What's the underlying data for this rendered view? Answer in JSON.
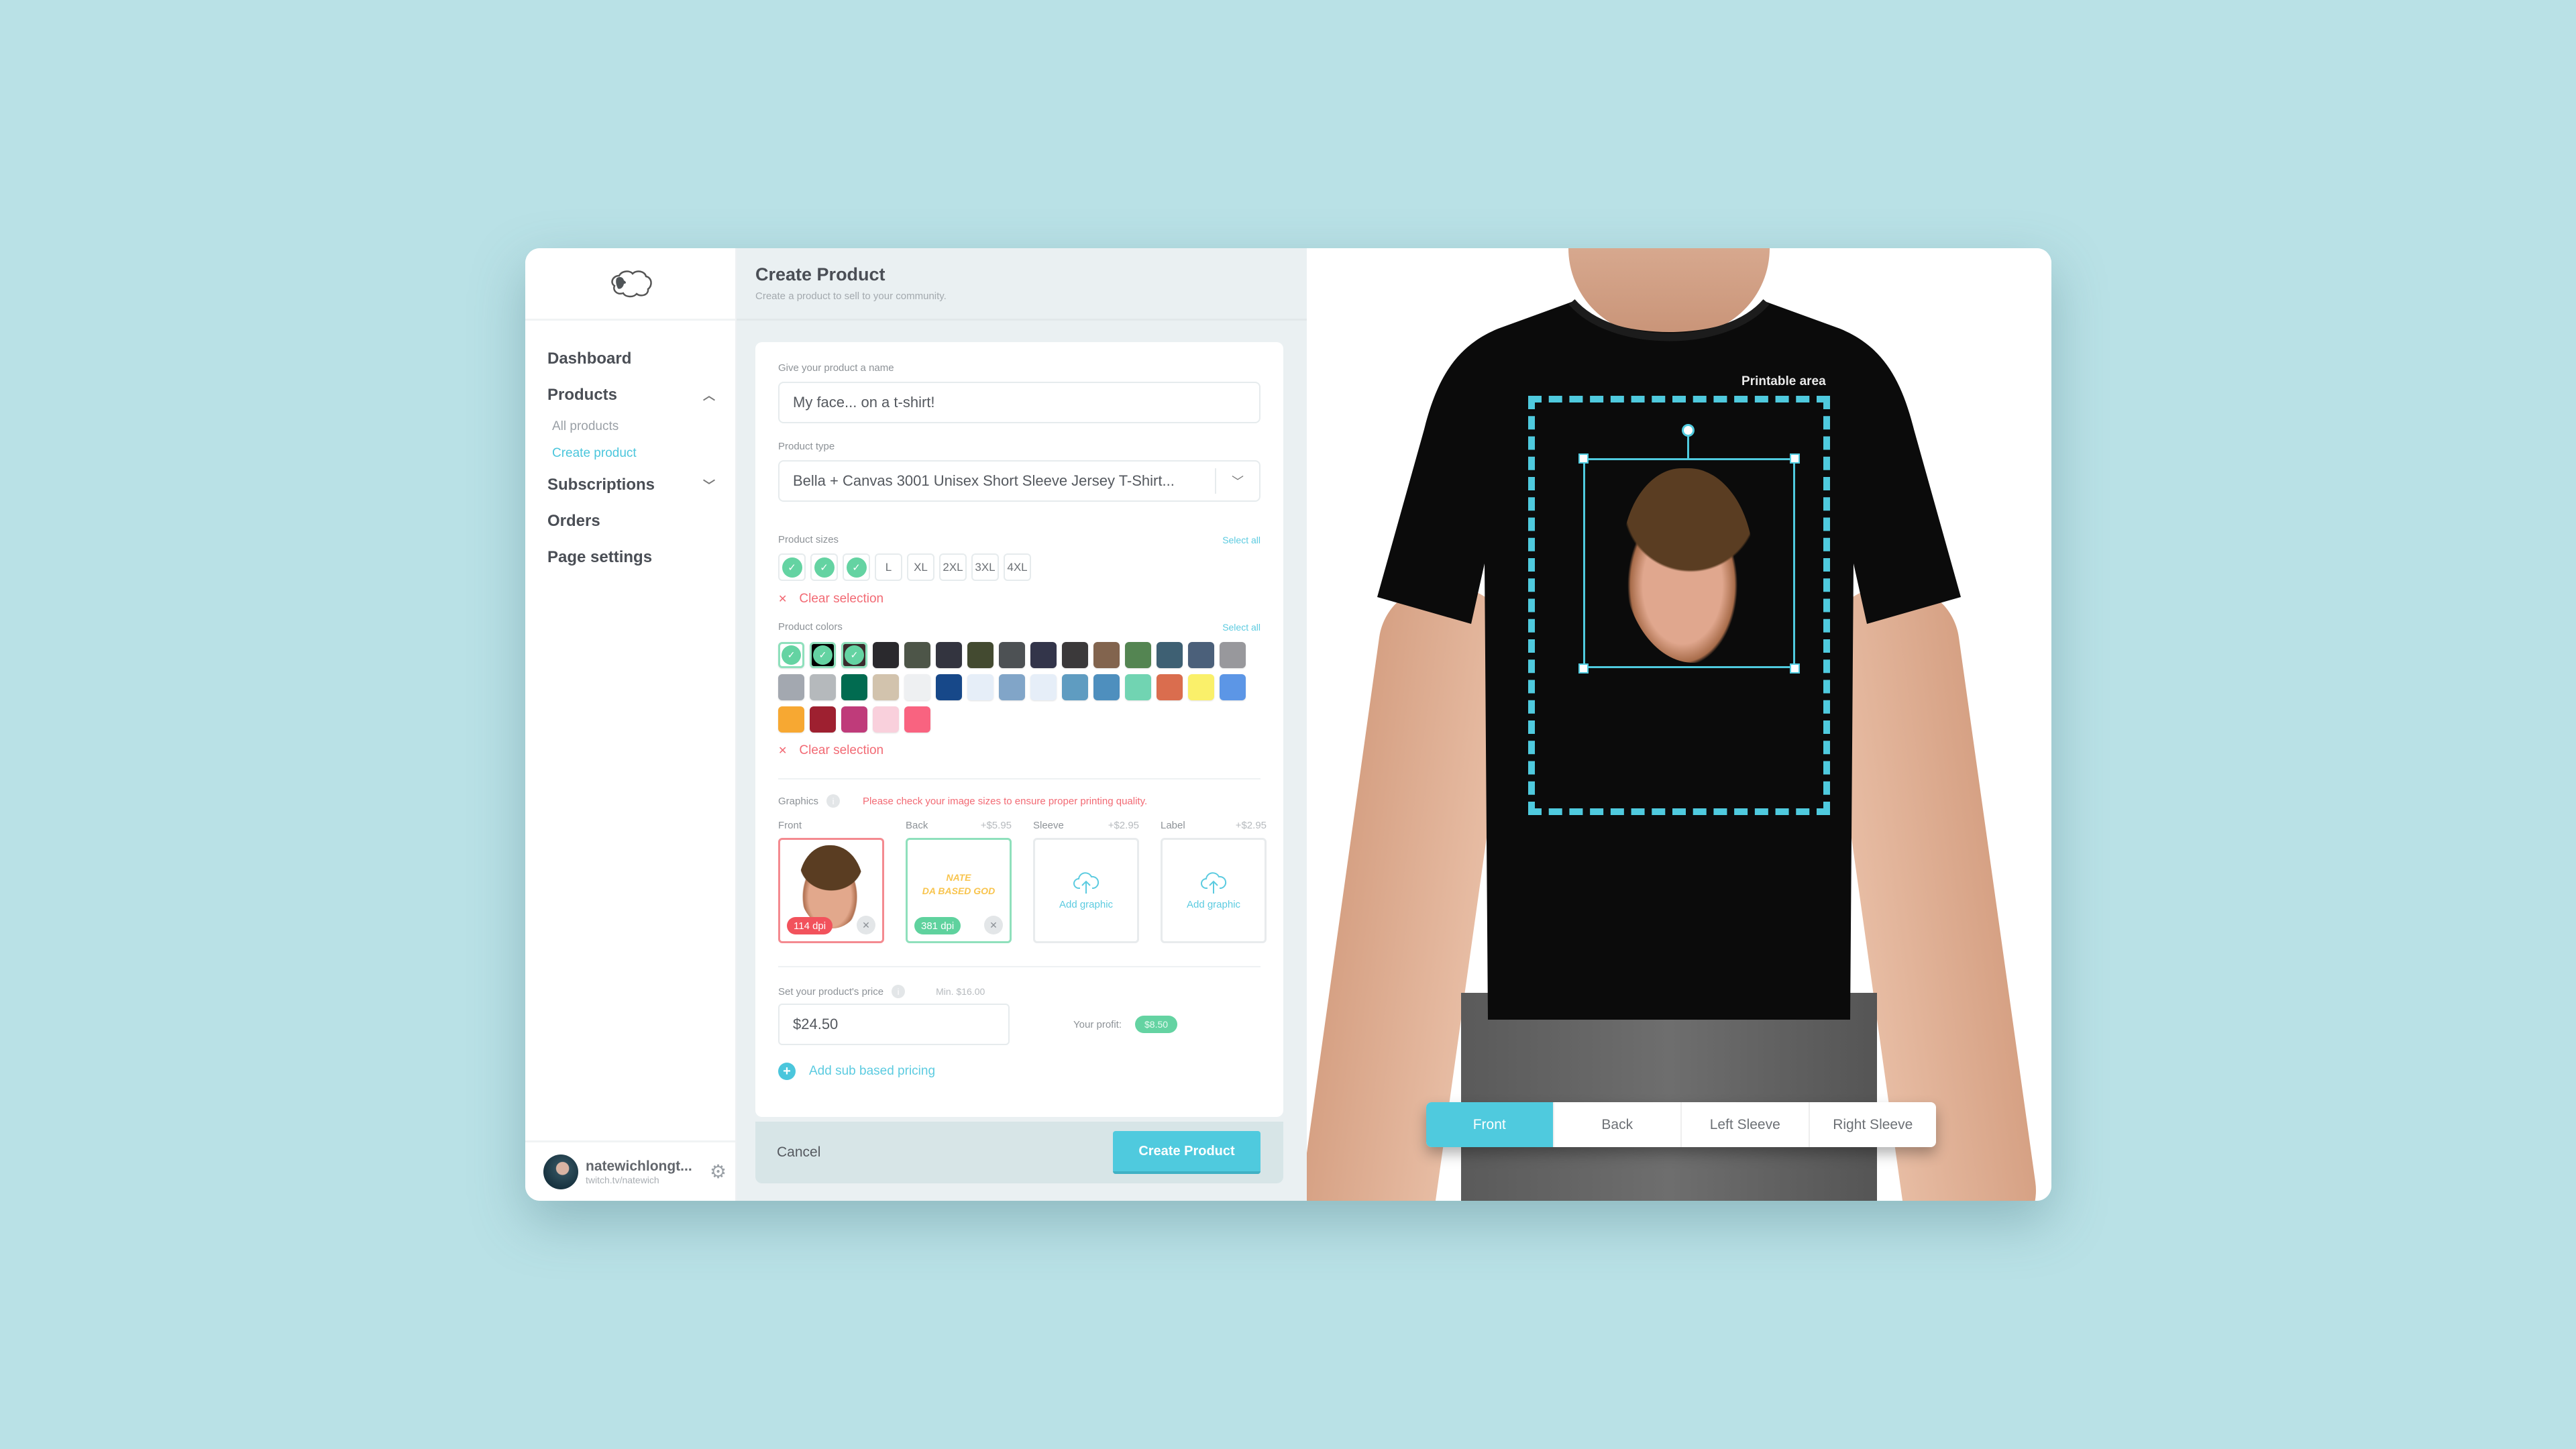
{
  "app": {
    "logo_icon": "sheep-logo-icon"
  },
  "sidebar": {
    "items": [
      {
        "label": "Dashboard"
      },
      {
        "label": "Products",
        "expanded": true,
        "children": [
          {
            "label": "All products",
            "active": false
          },
          {
            "label": "Create product",
            "active": true
          }
        ]
      },
      {
        "label": "Subscriptions",
        "expanded": false
      },
      {
        "label": "Orders"
      },
      {
        "label": "Page settings"
      }
    ],
    "user": {
      "name": "natewichlongt...",
      "link": "twitch.tv/natewich",
      "settings_icon": "gears-icon"
    }
  },
  "header": {
    "title": "Create Product",
    "subtitle": "Create a product to sell to your community."
  },
  "form": {
    "name_label": "Give your product a name",
    "name_value": "My face... on a t-shirt!",
    "type_label": "Product type",
    "type_value": "Bella + Canvas 3001 Unisex Short Sleeve Jersey T-Shirt...",
    "sizes_label": "Product sizes",
    "select_all": "Select all",
    "sizes": [
      {
        "label": "",
        "selected": true
      },
      {
        "label": "",
        "selected": true
      },
      {
        "label": "",
        "selected": true
      },
      {
        "label": "L",
        "selected": false
      },
      {
        "label": "XL",
        "selected": false
      },
      {
        "label": "2XL",
        "selected": false
      },
      {
        "label": "3XL",
        "selected": false
      },
      {
        "label": "4XL",
        "selected": false
      }
    ],
    "clear_selection": "Clear selection",
    "colors_label": "Product colors",
    "colors": [
      {
        "hex": "#ffffff",
        "selected": true
      },
      {
        "hex": "#000000",
        "selected": true
      },
      {
        "hex": "#3a2a2c",
        "selected": true
      },
      {
        "hex": "#2a292d",
        "selected": false
      },
      {
        "hex": "#4d5548",
        "selected": false
      },
      {
        "hex": "#33343f",
        "selected": false
      },
      {
        "hex": "#434a30",
        "selected": false
      },
      {
        "hex": "#4d5154",
        "selected": false
      },
      {
        "hex": "#33354a",
        "selected": false
      },
      {
        "hex": "#3b393a",
        "selected": false
      },
      {
        "hex": "#82644e",
        "selected": false
      },
      {
        "hex": "#548552",
        "selected": false
      },
      {
        "hex": "#3e6073",
        "selected": false
      },
      {
        "hex": "#4b607a",
        "selected": false
      },
      {
        "hex": "#98989c",
        "selected": false
      },
      {
        "hex": "#a3a8b0",
        "selected": false
      },
      {
        "hex": "#b5b9bc",
        "selected": false
      },
      {
        "hex": "#016b50",
        "selected": false
      },
      {
        "hex": "#d2c3ad",
        "selected": false
      },
      {
        "hex": "#eef0f2",
        "selected": false
      },
      {
        "hex": "#174889",
        "selected": false
      },
      {
        "hex": "#e6eef8",
        "selected": false
      },
      {
        "hex": "#81a5c8",
        "selected": false
      },
      {
        "hex": "#e6eef8",
        "selected": false
      },
      {
        "hex": "#5f9cc1",
        "selected": false
      },
      {
        "hex": "#4e8fbe",
        "selected": false
      },
      {
        "hex": "#71d4b2",
        "selected": false
      },
      {
        "hex": "#da6d4e",
        "selected": false
      },
      {
        "hex": "#faf06a",
        "selected": false
      },
      {
        "hex": "#5c96e6",
        "selected": false
      },
      {
        "hex": "#f7a832",
        "selected": false
      },
      {
        "hex": "#9e2030",
        "selected": false
      },
      {
        "hex": "#bf3b7a",
        "selected": false
      },
      {
        "hex": "#f9d0dc",
        "selected": false
      },
      {
        "hex": "#f96380",
        "selected": false
      }
    ],
    "graphics_label": "Graphics",
    "graphics_warning": "Please check your image sizes to ensure proper printing quality.",
    "graphics": [
      {
        "label": "Front",
        "price": "",
        "dpi": "114 dpi",
        "status": "bad",
        "content": "face-image"
      },
      {
        "label": "Back",
        "price": "+$5.95",
        "dpi": "381 dpi",
        "status": "good",
        "content_text": [
          "NATE",
          "DA BASED GOD"
        ]
      },
      {
        "label": "Sleeve",
        "price": "+$2.95",
        "add_text": "Add graphic"
      },
      {
        "label": "Label",
        "price": "+$2.95",
        "add_text": "Add graphic"
      }
    ],
    "price_label": "Set your product's price",
    "price_min": "Min. $16.00",
    "price_value": "$24.50",
    "profit_label": "Your profit:",
    "profit_value": "$8.50",
    "sub_pricing": "Add sub based pricing",
    "cancel": "Cancel",
    "create": "Create Product"
  },
  "preview": {
    "printable_area_label": "Printable area",
    "views": [
      {
        "label": "Front",
        "active": true
      },
      {
        "label": "Back",
        "active": false
      },
      {
        "label": "Left Sleeve",
        "active": false
      },
      {
        "label": "Right Sleeve",
        "active": false
      }
    ],
    "accent": "#4fcade"
  }
}
